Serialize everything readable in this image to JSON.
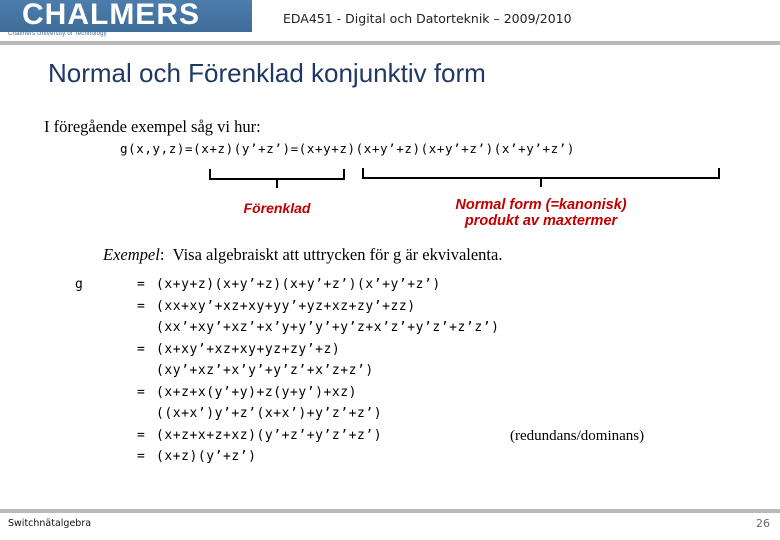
{
  "header": {
    "logo_wordmark": "CHALMERS",
    "logo_subtitle": "Chalmers University of Technology",
    "course_title": "EDA451 - Digital och Datorteknik – 2009/2010",
    "logo_color": "#4a7ba7"
  },
  "slide": {
    "title": "Normal och Förenklad konjunktiv form",
    "title_color": "#1f3864",
    "intro": "I föregående exempel såg vi hur:",
    "formula": "g(x,y,z)=(x+z)(y’+z’)=(x+y+z)(x+y’+z)(x+y’+z’)(x’+y’+z’)"
  },
  "annotations": {
    "accent_color": "#c00000",
    "simplified_label": "Förenklad",
    "normal_label_line1": "Normal form (=kanonisk)",
    "normal_label_line2": "produkt av maxtermer"
  },
  "example": {
    "keyword": "Exempel",
    "separator": ":",
    "text": "Visa algebraiskt att uttrycken för g är ekvivalenta."
  },
  "derivation": {
    "variable": "g",
    "equals": "=",
    "rows": [
      {
        "lhs": "g",
        "eq": "=",
        "expr": "(x+y+z)(x+y’+z)(x+y’+z’)(x’+y’+z’)",
        "note": ""
      },
      {
        "lhs": "",
        "eq": "=",
        "expr": "(xx+xy’+xz+xy+yy’+yz+xz+zy’+zz)",
        "note": ""
      },
      {
        "lhs": "",
        "eq": "",
        "expr": "(xx’+xy’+xz’+x’y+y’y’+y’z+x’z’+y’z’+z’z’)",
        "note": ""
      },
      {
        "lhs": "",
        "eq": "=",
        "expr": "(x+xy’+xz+xy+yz+zy’+z)",
        "note": ""
      },
      {
        "lhs": "",
        "eq": "",
        "expr": "(xy’+xz’+x’y’+y’z’+x’z+z’)",
        "note": ""
      },
      {
        "lhs": "",
        "eq": "=",
        "expr": "(x+z+x(y’+y)+z(y+y’)+xz)",
        "note": ""
      },
      {
        "lhs": "",
        "eq": "",
        "expr": "((x+x’)y’+z’(x+x’)+y’z’+z’)",
        "note": ""
      },
      {
        "lhs": "",
        "eq": "=",
        "expr": "(x+z+x+z+xz)(y’+z’+y’z’+z’)",
        "note": "(redundans/dominans)"
      },
      {
        "lhs": "",
        "eq": "=",
        "expr": "(x+z)(y’+z’)",
        "note": ""
      }
    ]
  },
  "footer": {
    "section": "Switchnätalgebra",
    "page_number": "26"
  }
}
